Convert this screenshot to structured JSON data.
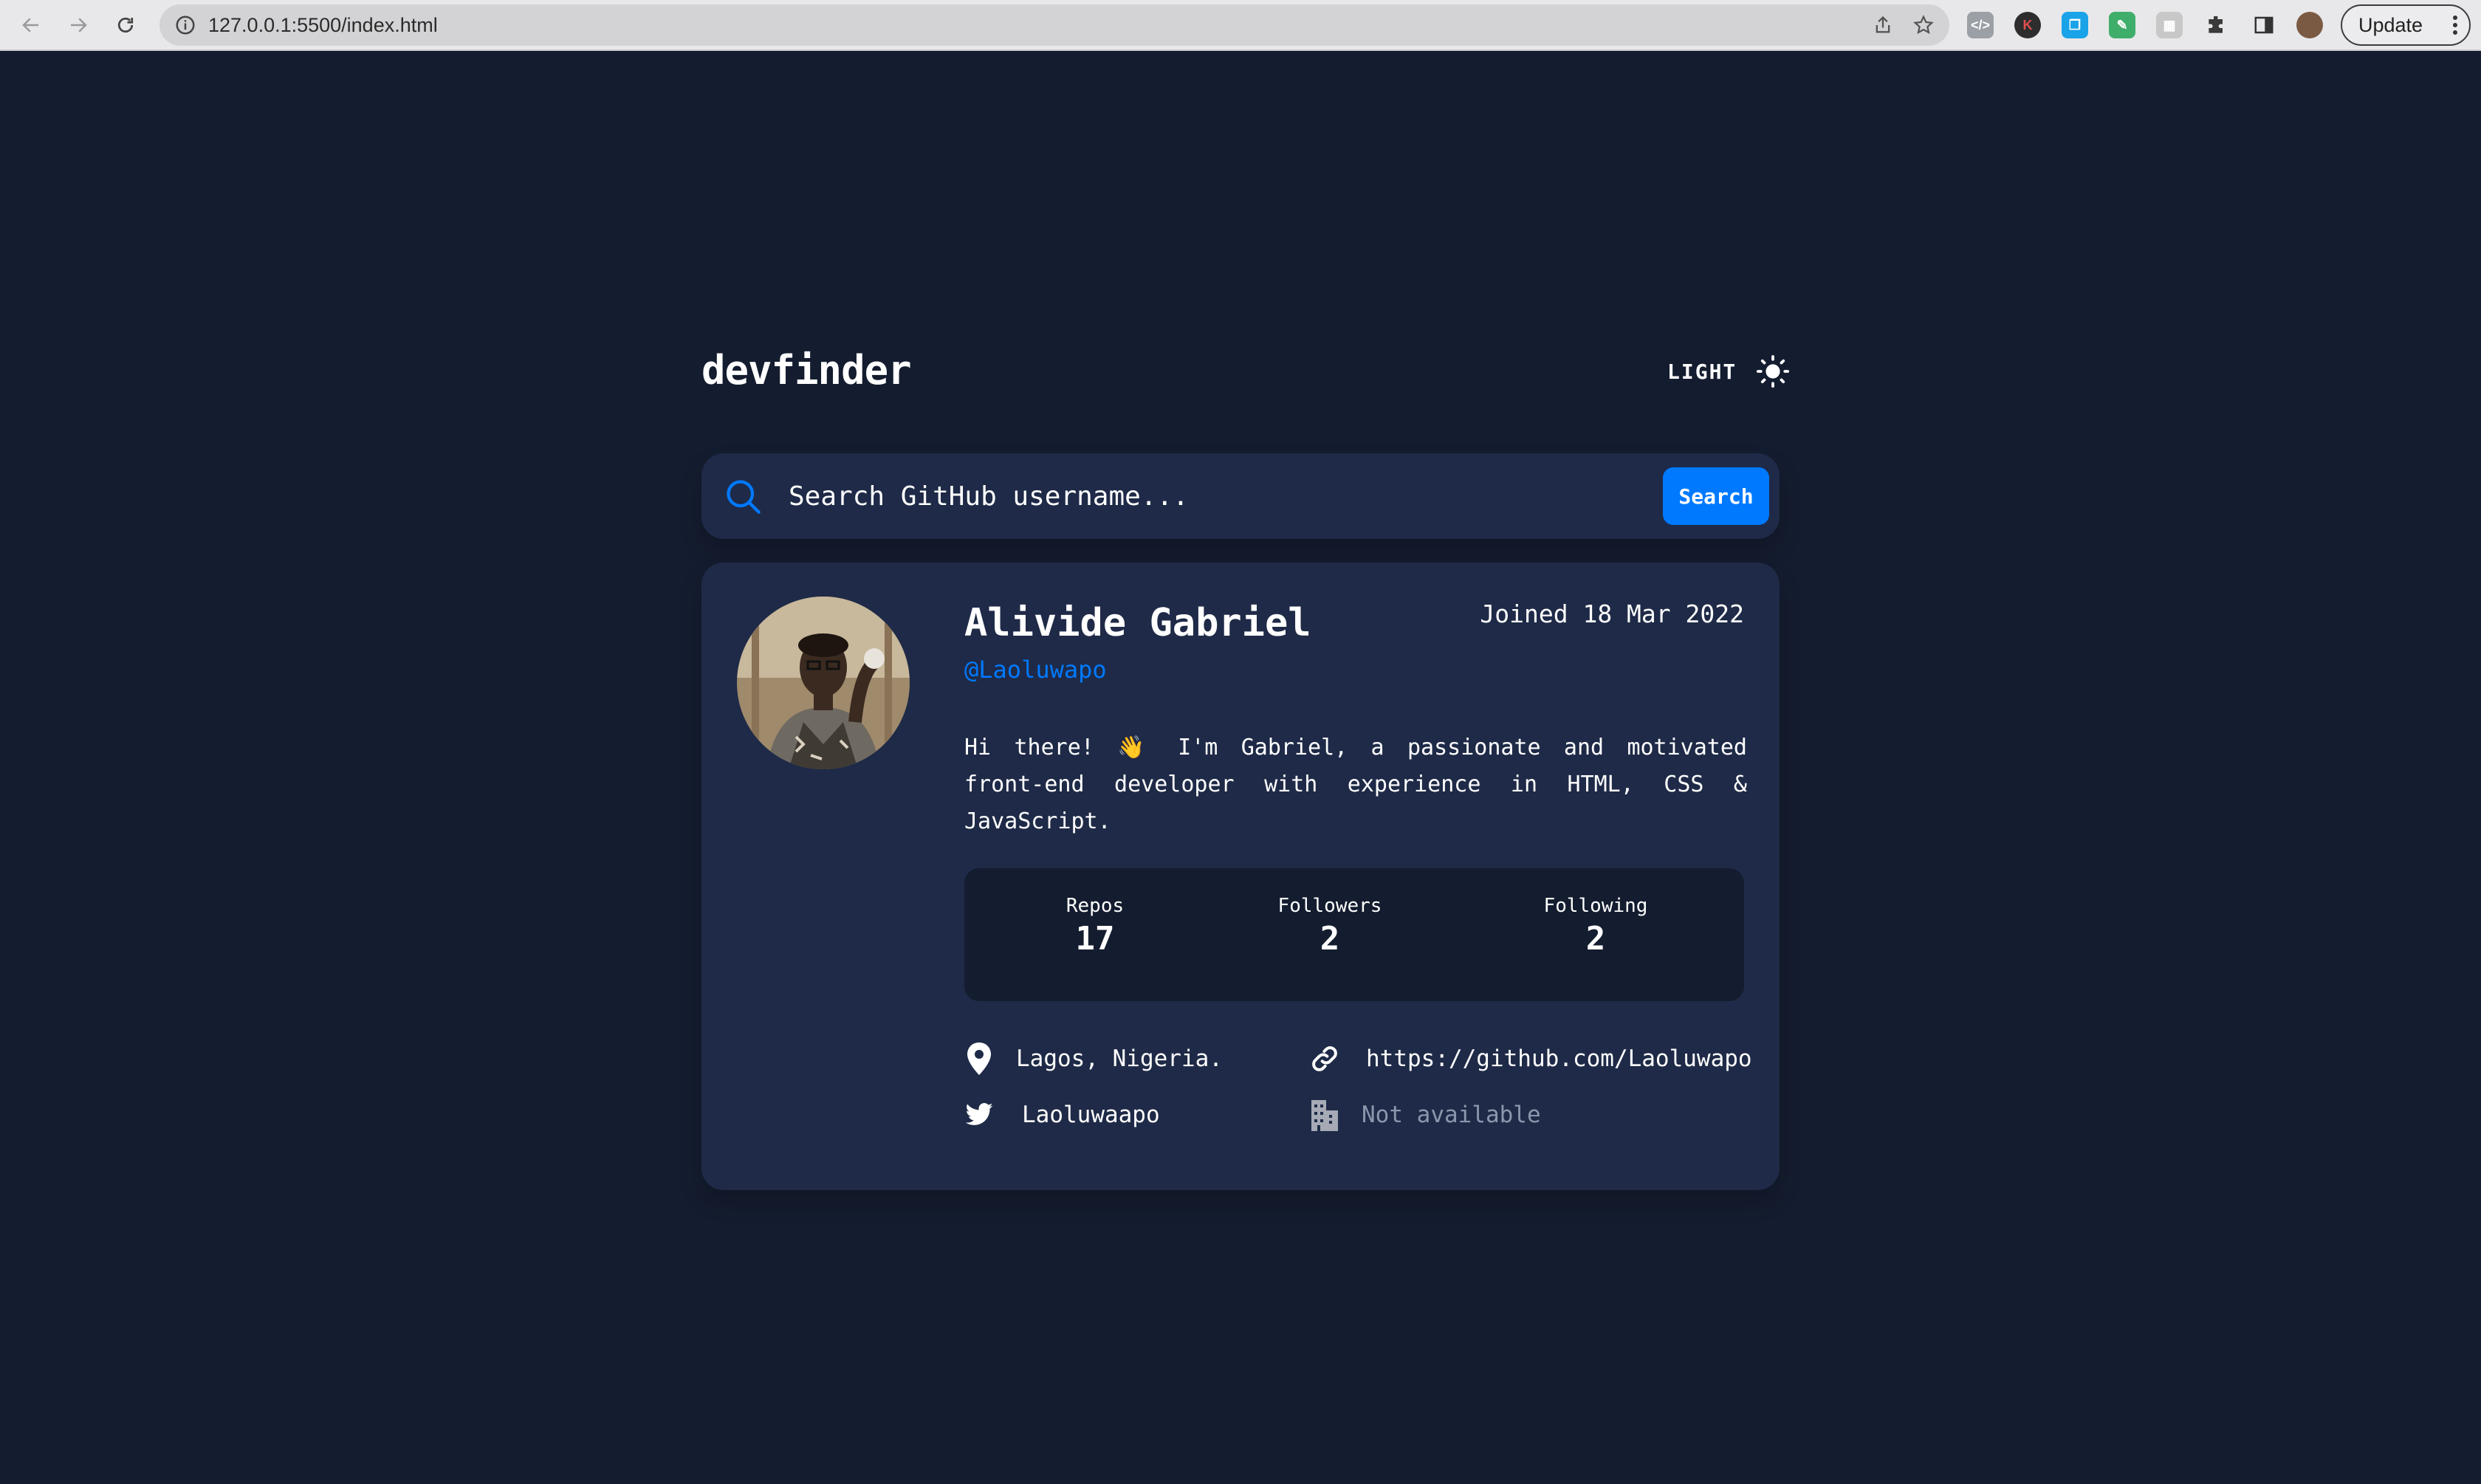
{
  "browser": {
    "url": "127.0.0.1:5500/index.html",
    "update_label": "Update"
  },
  "app": {
    "title": "devfinder",
    "theme_toggle_label": "LIGHT"
  },
  "search": {
    "placeholder": "Search GitHub username...",
    "button_label": "Search"
  },
  "profile": {
    "name": "Alivide Gabriel",
    "handle": "@Laoluwapo",
    "joined": "Joined 18 Mar 2022",
    "bio": "Hi there! 👋 I'm Gabriel, a passionate and motivated front-end developer with experience in HTML, CSS & JavaScript.",
    "stats": [
      {
        "label": "Repos",
        "value": "17"
      },
      {
        "label": "Followers",
        "value": "2"
      },
      {
        "label": "Following",
        "value": "2"
      }
    ],
    "location": "Lagos, Nigeria.",
    "blog": "https://github.com/Laoluwapo",
    "twitter": "Laoluwaapo",
    "company": "Not available"
  },
  "colors": {
    "page_bg": "#141c2f",
    "card_bg": "#1e2a47",
    "accent": "#0079ff",
    "muted": "#8c96ad"
  },
  "icons": [
    "back-arrow-icon",
    "forward-arrow-icon",
    "reload-icon",
    "info-icon",
    "share-icon",
    "bookmark-star-icon",
    "puzzle-extensions-icon",
    "sidebar-icon",
    "profile-avatar-icon",
    "sun-icon",
    "search-icon",
    "location-pin-icon",
    "link-icon",
    "twitter-icon",
    "office-building-icon"
  ]
}
